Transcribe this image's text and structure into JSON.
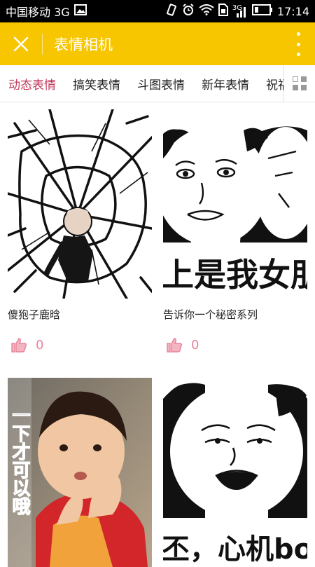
{
  "status_bar": {
    "carrier": "中国移动 3G",
    "network_small": "3G",
    "time": "17:14"
  },
  "app_bar": {
    "title": "表情相机",
    "close_icon": "close-icon",
    "more_icon": "more-vertical-icon"
  },
  "tabs": [
    {
      "label": "动态表情",
      "active": true
    },
    {
      "label": "搞笑表情",
      "active": false
    },
    {
      "label": "斗图表情",
      "active": false
    },
    {
      "label": "新年表情",
      "active": false
    },
    {
      "label": "祝福",
      "active": false
    }
  ],
  "tabs_more_icon": "grid-icon",
  "cards": [
    {
      "caption": "傻狍子鹿晗",
      "likes": "0",
      "image_text": ""
    },
    {
      "caption": "告诉你一个秘密系列",
      "likes": "0",
      "image_text": "上是我女朋"
    },
    {
      "caption": "",
      "likes": "",
      "image_text": "一下才可以哦"
    },
    {
      "caption": "",
      "likes": "",
      "image_text": "丕，心机boy"
    }
  ],
  "colors": {
    "app_bar": "#f7c600",
    "active_tab": "#c0395b",
    "like": "#e8839a"
  }
}
